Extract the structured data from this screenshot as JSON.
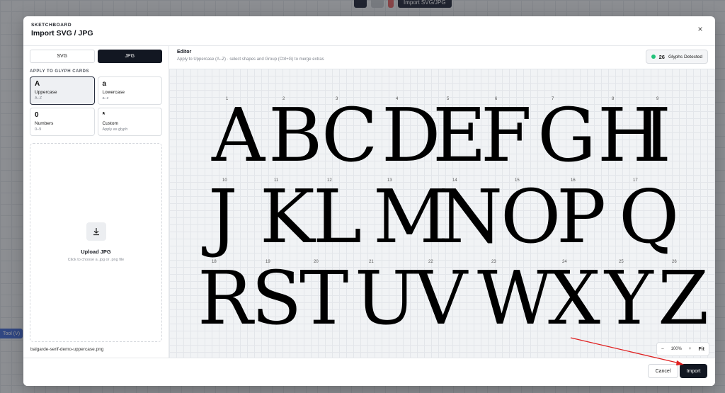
{
  "background": {
    "toolbar_import_label": "Import SVG/JPG",
    "side_tag": "Tool (V)"
  },
  "modal": {
    "brand": "SKETCHBOARD",
    "title": "Import SVG / JPG",
    "close_symbol": "×"
  },
  "left": {
    "tabs": [
      {
        "label": "SVG",
        "active": false
      },
      {
        "label": "JPG",
        "active": true
      }
    ],
    "section_label": "APPLY TO GLYPH CARDS",
    "cards": [
      {
        "glyph": "A",
        "title": "Uppercase",
        "sub": "A–Z",
        "active": true
      },
      {
        "glyph": "a",
        "title": "Lowercase",
        "sub": "a–z",
        "active": false
      },
      {
        "glyph": "0",
        "title": "Numbers",
        "sub": "0–9",
        "active": false
      },
      {
        "glyph": "*",
        "title": "Custom",
        "sub": "Apply as glyph",
        "active": false
      }
    ],
    "upload_title": "Upload JPG",
    "upload_sub": "Click to choose a .jpg or .png file",
    "filename": "balgarde-serif-demo-uppercase.png"
  },
  "editor": {
    "title": "Editor",
    "subtitle": "Apply to Uppercase (A–Z) · select shapes and Group (Ctrl+G) to merge extras",
    "detected_count": "26",
    "detected_label": "Glyphs Detected",
    "zoom_minus": "–",
    "zoom_value": "100%",
    "zoom_plus": "+",
    "zoom_fit": "Fit"
  },
  "glyphs": [
    {
      "idx": "1",
      "char": "A"
    },
    {
      "idx": "2",
      "char": "B"
    },
    {
      "idx": "3",
      "char": "C"
    },
    {
      "idx": "4",
      "char": "D"
    },
    {
      "idx": "5",
      "char": "E"
    },
    {
      "idx": "6",
      "char": "F"
    },
    {
      "idx": "7",
      "char": "G"
    },
    {
      "idx": "8",
      "char": "H"
    },
    {
      "idx": "9",
      "char": "I"
    },
    {
      "idx": "10",
      "char": "J"
    },
    {
      "idx": "11",
      "char": "K"
    },
    {
      "idx": "12",
      "char": "L"
    },
    {
      "idx": "13",
      "char": "M"
    },
    {
      "idx": "14",
      "char": "N"
    },
    {
      "idx": "15",
      "char": "O"
    },
    {
      "idx": "16",
      "char": "P"
    },
    {
      "idx": "17",
      "char": "Q"
    },
    {
      "idx": "18",
      "char": "R"
    },
    {
      "idx": "19",
      "char": "S"
    },
    {
      "idx": "20",
      "char": "T"
    },
    {
      "idx": "21",
      "char": "U"
    },
    {
      "idx": "22",
      "char": "V"
    },
    {
      "idx": "23",
      "char": "W"
    },
    {
      "idx": "24",
      "char": "X"
    },
    {
      "idx": "25",
      "char": "Y"
    },
    {
      "idx": "26",
      "char": "Z"
    }
  ],
  "footer": {
    "cancel": "Cancel",
    "import": "Import"
  },
  "colors": {
    "annotation_arrow": "#e02020",
    "detected_dot": "#22c37a",
    "primary": "#121722"
  }
}
